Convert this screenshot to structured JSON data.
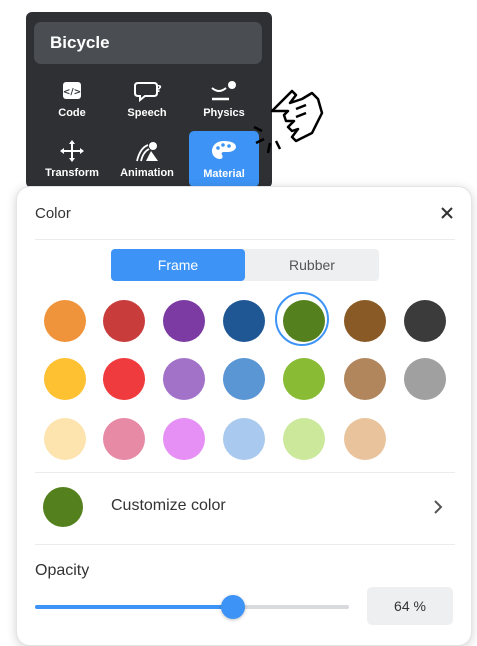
{
  "object_panel": {
    "title": "Bicycle",
    "tools": [
      {
        "label": "Code",
        "icon": "code-icon"
      },
      {
        "label": "Speech",
        "icon": "speech-bubble-icon"
      },
      {
        "label": "Physics",
        "icon": "physics-icon"
      },
      {
        "label": "Transform",
        "icon": "move-arrows-icon"
      },
      {
        "label": "Animation",
        "icon": "animation-icon"
      },
      {
        "label": "Material",
        "icon": "palette-icon",
        "active": true
      }
    ]
  },
  "color_popup": {
    "title": "Color",
    "close_icon": "close-icon",
    "tabs": [
      {
        "label": "Frame",
        "active": true
      },
      {
        "label": "Rubber",
        "active": false
      }
    ],
    "swatches": [
      [
        "#f0943c",
        "#c93c3c",
        "#7c3aa3",
        "#1f5795",
        "#54801d",
        "#895a26",
        "#3b3b3b"
      ],
      [
        "#fdc132",
        "#f03b3e",
        "#a272c9",
        "#5a95d4",
        "#89bb35",
        "#b1865c",
        "#a0a0a0"
      ],
      [
        "#fde4ae",
        "#e78aa6",
        "#e68ff5",
        "#a9c9ee",
        "#cbe89b",
        "#e9c39c"
      ]
    ],
    "selected_swatch": "#54801d",
    "customize": {
      "label": "Customize color",
      "color": "#54801d",
      "chevron_icon": "chevron-right-icon"
    },
    "opacity": {
      "label": "Opacity",
      "value_text": "64 %",
      "fraction": 0.64
    }
  },
  "accent_color": "#3d94f6"
}
